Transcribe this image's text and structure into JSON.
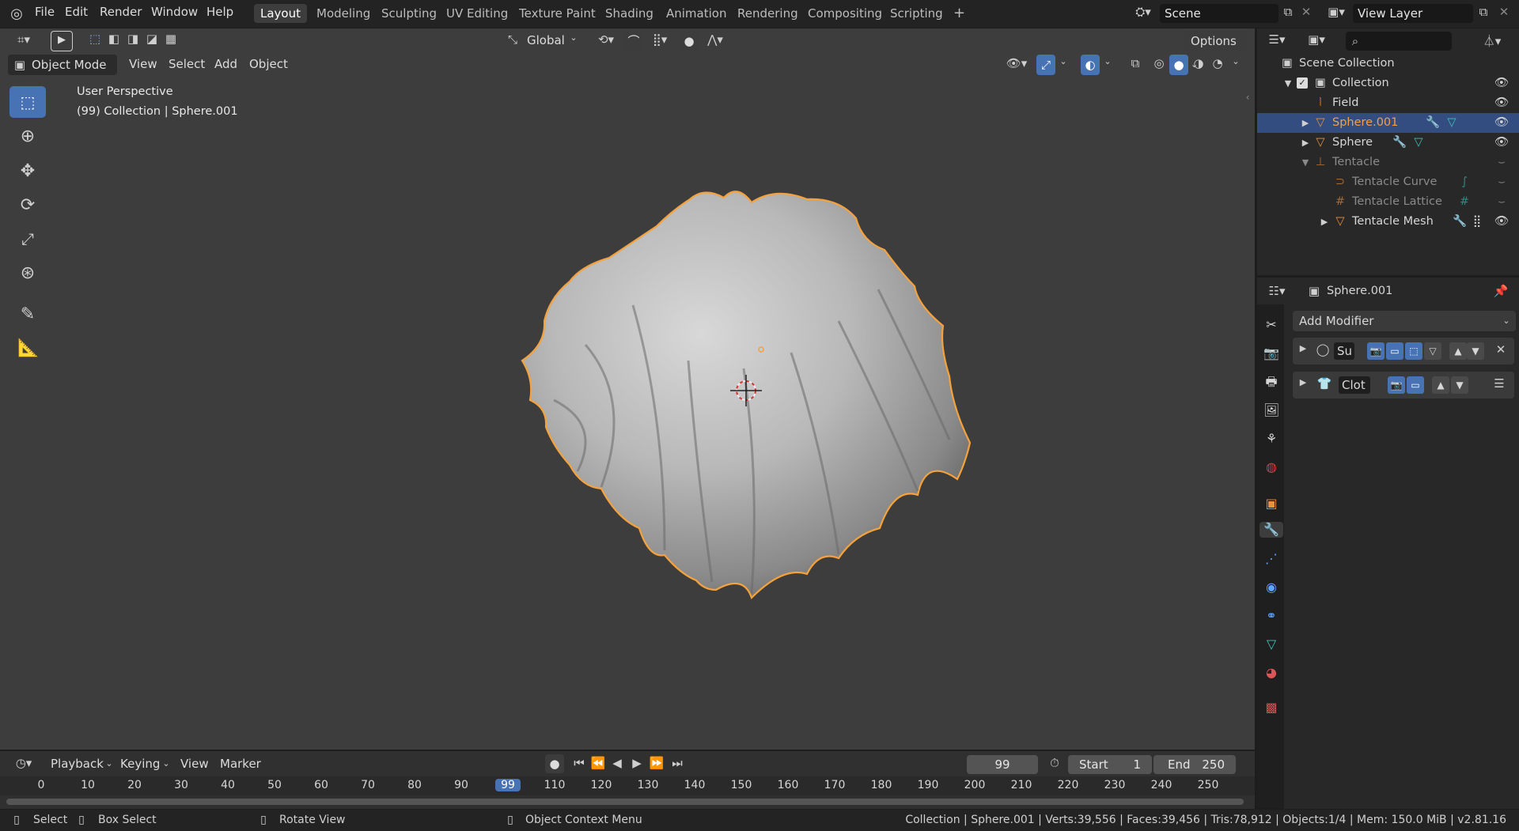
{
  "topbar": {
    "menu": [
      "File",
      "Edit",
      "Render",
      "Window",
      "Help"
    ],
    "workspaces": [
      "Layout",
      "Modeling",
      "Sculpting",
      "UV Editing",
      "Texture Paint",
      "Shading",
      "Animation",
      "Rendering",
      "Compositing",
      "Scripting"
    ],
    "active_workspace": "Layout",
    "add_workspace": "+",
    "scene": "Scene",
    "view_layer": "View Layer"
  },
  "viewport": {
    "transform_orientation": "Global",
    "options_label": "Options",
    "mode": "Object Mode",
    "header_menu": [
      "View",
      "Select",
      "Add",
      "Object"
    ],
    "overlay_title": "User Perspective",
    "overlay_subtitle": "(99) Collection | Sphere.001"
  },
  "outliner": {
    "search_placeholder": "",
    "items": [
      {
        "label": "Scene Collection",
        "icon": "scene-collection-icon",
        "dim": false
      },
      {
        "label": "Collection",
        "icon": "collection-icon",
        "dim": false
      },
      {
        "label": "Field",
        "icon": "force-field-icon",
        "dim": false
      },
      {
        "label": "Sphere.001",
        "icon": "mesh-object-icon",
        "dim": false,
        "selected": true
      },
      {
        "label": "Sphere",
        "icon": "mesh-object-icon",
        "dim": false
      },
      {
        "label": "Tentacle",
        "icon": "empty-object-icon",
        "dim": true
      },
      {
        "label": "Tentacle Curve",
        "icon": "curve-object-icon",
        "dim": true
      },
      {
        "label": "Tentacle Lattice",
        "icon": "lattice-object-icon",
        "dim": true
      },
      {
        "label": "Tentacle Mesh",
        "icon": "mesh-object-icon",
        "dim": false
      }
    ]
  },
  "properties": {
    "object_name": "Sphere.001",
    "add_modifier": "Add Modifier",
    "modifiers": [
      {
        "name": "Su"
      },
      {
        "name": "Clot"
      }
    ]
  },
  "timeline": {
    "menu": [
      "Playback",
      "Keying",
      "View",
      "Marker"
    ],
    "current_frame": "99",
    "start_label": "Start",
    "start": "1",
    "end_label": "End",
    "end": "250",
    "ticks": [
      "0",
      "10",
      "20",
      "30",
      "40",
      "50",
      "60",
      "70",
      "80",
      "90",
      "99",
      "110",
      "120",
      "130",
      "140",
      "150",
      "160",
      "170",
      "180",
      "190",
      "200",
      "210",
      "220",
      "230",
      "240",
      "250"
    ]
  },
  "statusbar": {
    "select": "Select",
    "box_select": "Box Select",
    "rotate_view": "Rotate View",
    "context_menu": "Object Context Menu",
    "stats": "Collection | Sphere.001 | Verts:39,556 | Faces:39,456 | Tris:78,912 | Objects:1/4 | Mem: 150.0 MiB | v2.81.16"
  },
  "colors": {
    "accent": "#4772b3",
    "selection_outline": "#f5a23d",
    "selected_text": "#f0a14a",
    "modifier_icon": "#5ea3ff",
    "data_icon": "#3fc1b5"
  }
}
